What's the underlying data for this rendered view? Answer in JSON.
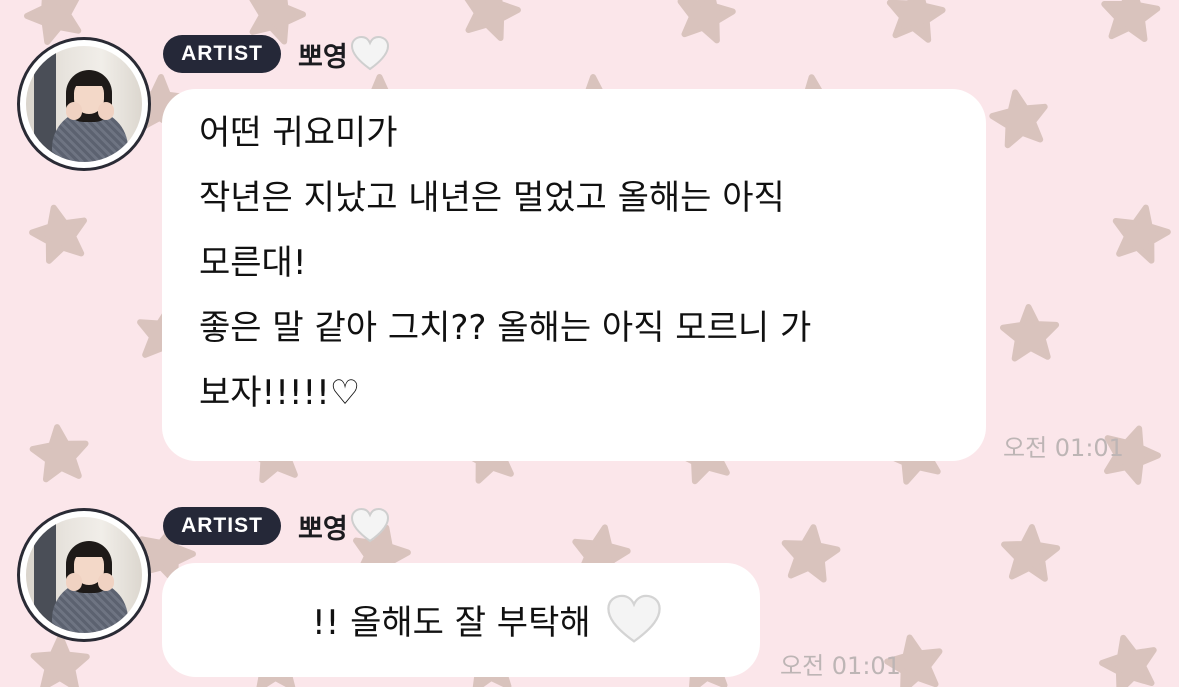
{
  "messages": [
    {
      "badge": "ARTIST",
      "sender": "뽀영",
      "sender_icon": "white-heart-icon",
      "lines": [
        "어떤 귀요미가",
        "작년은 지났고 내년은 멀었고 올해는 아직",
        "모른대!",
        "좋은 말 같아 그치?? 올해는 아직 모르니 가",
        "보자!!!!!♡"
      ],
      "time": "오전 01:01"
    },
    {
      "badge": "ARTIST",
      "sender": "뽀영",
      "sender_icon": "white-heart-icon",
      "text": "!! 올해도 잘 부탁해",
      "text_icon": "white-heart-icon",
      "time": "오전 01:01"
    }
  ],
  "colors": {
    "background": "#fbe6ea",
    "star": "#d9c3bd",
    "badge": "#252838",
    "bubble": "#ffffff",
    "timestamp": "#bdb5b5"
  }
}
